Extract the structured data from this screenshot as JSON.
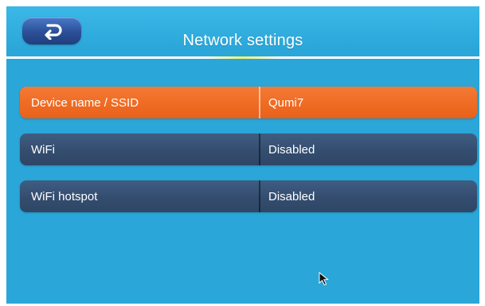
{
  "header": {
    "title": "Network settings",
    "back_icon": "back-return-icon"
  },
  "colors": {
    "background": "#2aa6d8",
    "row_normal": "#344d6f",
    "row_selected": "#ee6a22",
    "divider_highlight": "#f3f26a",
    "back_button": "#2b4f98"
  },
  "settings": [
    {
      "label": "Device name / SSID",
      "value": "Qumi7",
      "selected": true
    },
    {
      "label": "WiFi",
      "value": "Disabled",
      "selected": false
    },
    {
      "label": "WiFi hotspot",
      "value": "Disabled",
      "selected": false
    }
  ],
  "cursor_icon": "mouse-pointer-icon"
}
